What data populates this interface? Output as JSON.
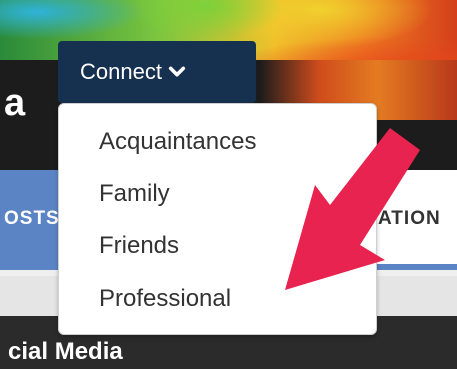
{
  "site": {
    "title_fragment": "a"
  },
  "connect": {
    "label": "Connect",
    "menu": [
      "Acquaintances",
      "Family",
      "Friends",
      "Professional"
    ]
  },
  "tabs": {
    "left_fragment": "OSTS",
    "right_fragment": "ATION"
  },
  "footer": {
    "heading_fragment": "cial Media"
  },
  "colors": {
    "connect_button": "#16304f",
    "tab_accent": "#5b84c4",
    "arrow": "#e8234f"
  },
  "icons": {
    "connect_chevron": "chevron-down-icon",
    "annotation_arrow": "arrow-icon"
  }
}
